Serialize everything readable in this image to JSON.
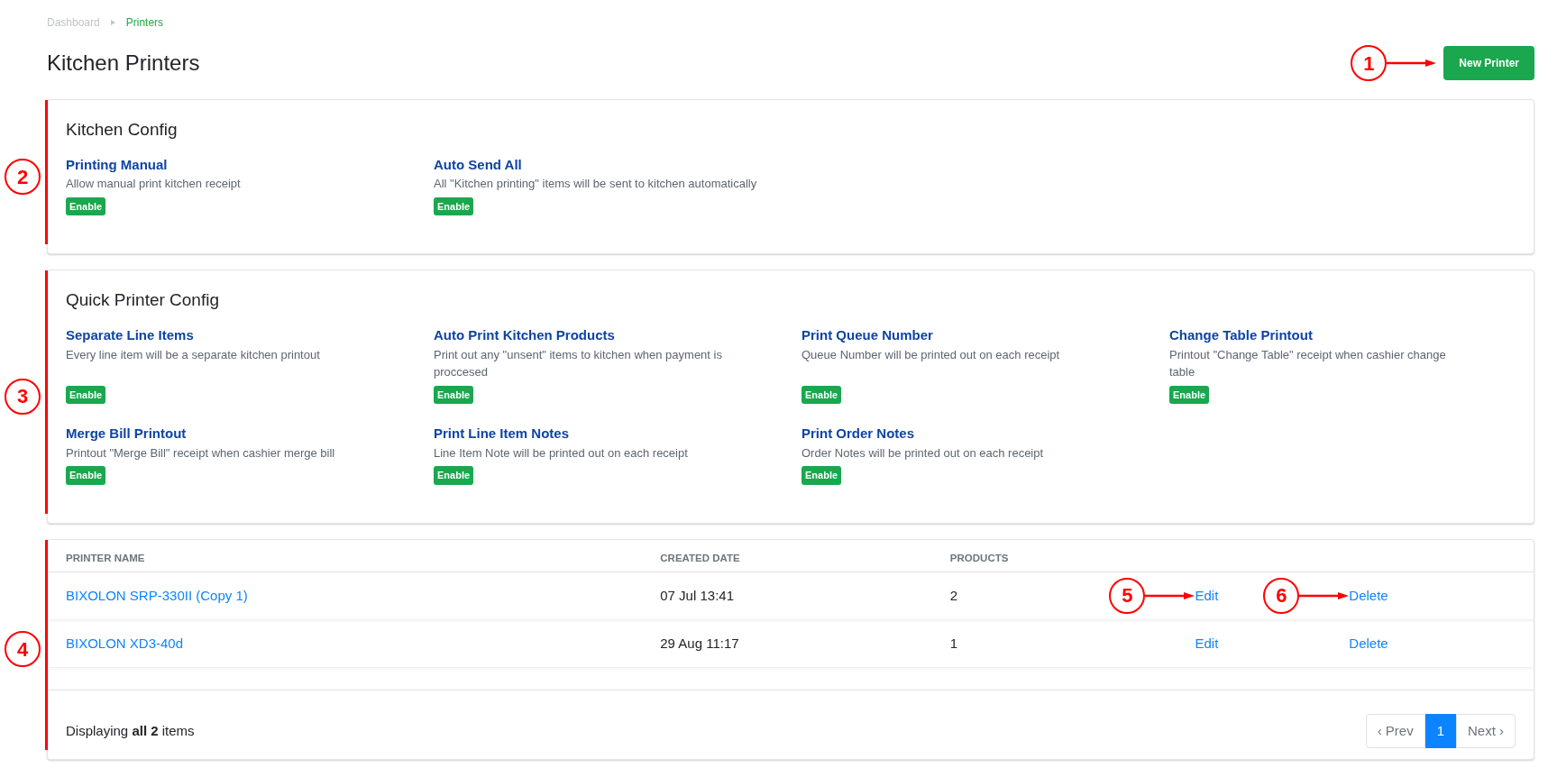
{
  "breadcrumb": [
    {
      "label": "Dashboard",
      "selected": false
    },
    {
      "label": "Printers",
      "selected": true
    }
  ],
  "header": {
    "title": "Kitchen Printers",
    "button": "New Printer",
    "callout": "1"
  },
  "kitchen_config": {
    "title": "Kitchen Config",
    "callout": "2",
    "items": [
      {
        "title": "Printing Manual",
        "description": "Allow manual print kitchen receipt",
        "badge": "Enable"
      },
      {
        "title": "Auto Send All",
        "description": "All \"Kitchen printing\" items will be sent to kitchen automatically",
        "badge": "Enable"
      }
    ]
  },
  "quick_printer_config": {
    "title": "Quick Printer Config",
    "callout": "3",
    "items": [
      {
        "title": "Separate Line Items",
        "description": "Every line item will be a separate kitchen printout",
        "badge": "Enable"
      },
      {
        "title": "Auto Print Kitchen Products",
        "description": "Print out any \"unsent\" items to kitchen when payment is proccesed",
        "badge": "Enable"
      },
      {
        "title": "Print Queue Number",
        "description": "Queue Number will be printed out on each receipt",
        "badge": "Enable"
      },
      {
        "title": "Change Table Printout",
        "description": "Printout \"Change Table\" receipt when cashier change table",
        "badge": "Enable"
      },
      {
        "title": "Merge Bill Printout",
        "description": "Printout \"Merge Bill\" receipt when cashier merge bill",
        "badge": "Enable"
      },
      {
        "title": "Print Line Item Notes",
        "description": "Line Item Note will be printed out on each receipt",
        "badge": "Enable"
      },
      {
        "title": "Print Order Notes",
        "description": "Order Notes will be printed out on each receipt",
        "badge": "Enable"
      }
    ]
  },
  "table": {
    "callout": "4",
    "columns": [
      "PRINTER NAME",
      "CREATED DATE",
      "PRODUCTS"
    ],
    "rows": [
      {
        "name": "BIXOLON SRP-330II (Copy 1)",
        "created": "07 Jul 13:41",
        "products": "2",
        "edit": "Edit",
        "delete": "Delete",
        "edit_callout": "5",
        "delete_callout": "6"
      },
      {
        "name": "BIXOLON XD3-40d",
        "created": "29 Aug 11:17",
        "products": "1",
        "edit": "Edit",
        "delete": "Delete"
      }
    ],
    "footer": "Displaying **all 2** items",
    "pagination": [
      {
        "label": "‹ Prev",
        "selected": false
      },
      {
        "label": "1",
        "selected": true
      },
      {
        "label": "Next ›",
        "selected": false
      }
    ]
  }
}
